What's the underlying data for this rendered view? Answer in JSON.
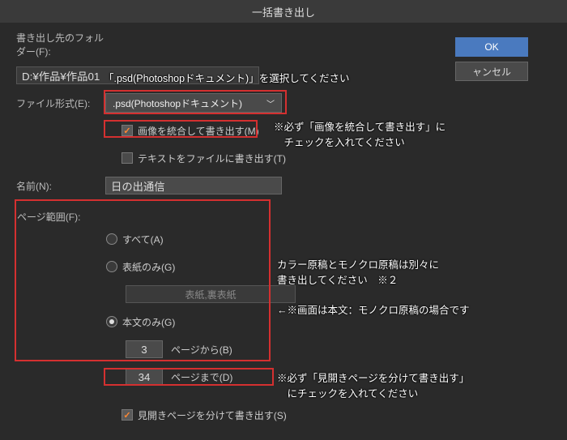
{
  "title": "一括書き出し",
  "folder_label": "書き出し先のフォルダー(F):",
  "folder_path": "D:¥作品¥作品01",
  "format_label": "ファイル形式(E):",
  "format_value": ".psd(Photoshopドキュメント)",
  "merge_label": "画像を統合して書き出す(M)",
  "text_export_label": "テキストをファイルに書き出す(T)",
  "name_label": "名前(N):",
  "name_value": "日の出通信",
  "pagerange_label": "ページ範囲(F):",
  "radio_all": "すべて(A)",
  "radio_cover": "表紙のみ(G)",
  "cover_text": "表紙,裏表紙",
  "radio_body": "本文のみ(G)",
  "page_from_value": "3",
  "page_from_label": "ページから(B)",
  "page_to_value": "34",
  "page_to_label": "ページまで(D)",
  "spread_label": "見開きページを分けて書き出す(S)",
  "ok_label": "OK",
  "cancel_label": "ャンセル",
  "note1": "「.psd(Photoshopドキュメント)」を選択してください",
  "note2a": "※必ず「画像を統合して書き出す」に",
  "note2b": "　チェックを入れてください",
  "note3a": "カラー原稿とモノクロ原稿は別々に",
  "note3b": "書き出してください　※２",
  "note4": "←※画面は本文：モノクロ原稿の場合です",
  "note5a": "※必ず「見開きページを分けて書き出す」",
  "note5b": "　にチェックを入れてください"
}
